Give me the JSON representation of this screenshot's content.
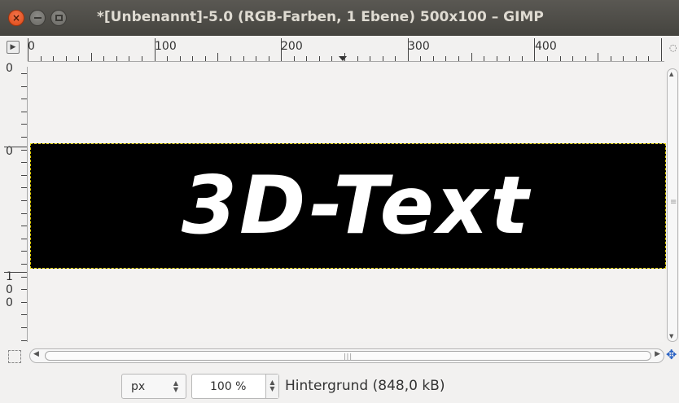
{
  "window": {
    "title": "*[Unbenannt]-5.0 (RGB-Farben, 1 Ebene) 500x100 – GIMP",
    "close_glyph": "×",
    "close_icon": "close-icon",
    "minimize_icon": "minimize-icon",
    "maximize_icon": "maximize-icon"
  },
  "rulers": {
    "horizontal_labels": [
      "0",
      "100",
      "200",
      "300",
      "400"
    ],
    "vertical_labels": [
      "0",
      "0",
      "1\n0\n0"
    ]
  },
  "canvas": {
    "image_text": "3D-Text",
    "image_background": "#000000",
    "text_color": "#ffffff",
    "selection_color": "#e3d100"
  },
  "statusbar": {
    "unit": "px",
    "zoom": "100 %",
    "layer_info": "Hintergrund (848,0 kB)"
  }
}
